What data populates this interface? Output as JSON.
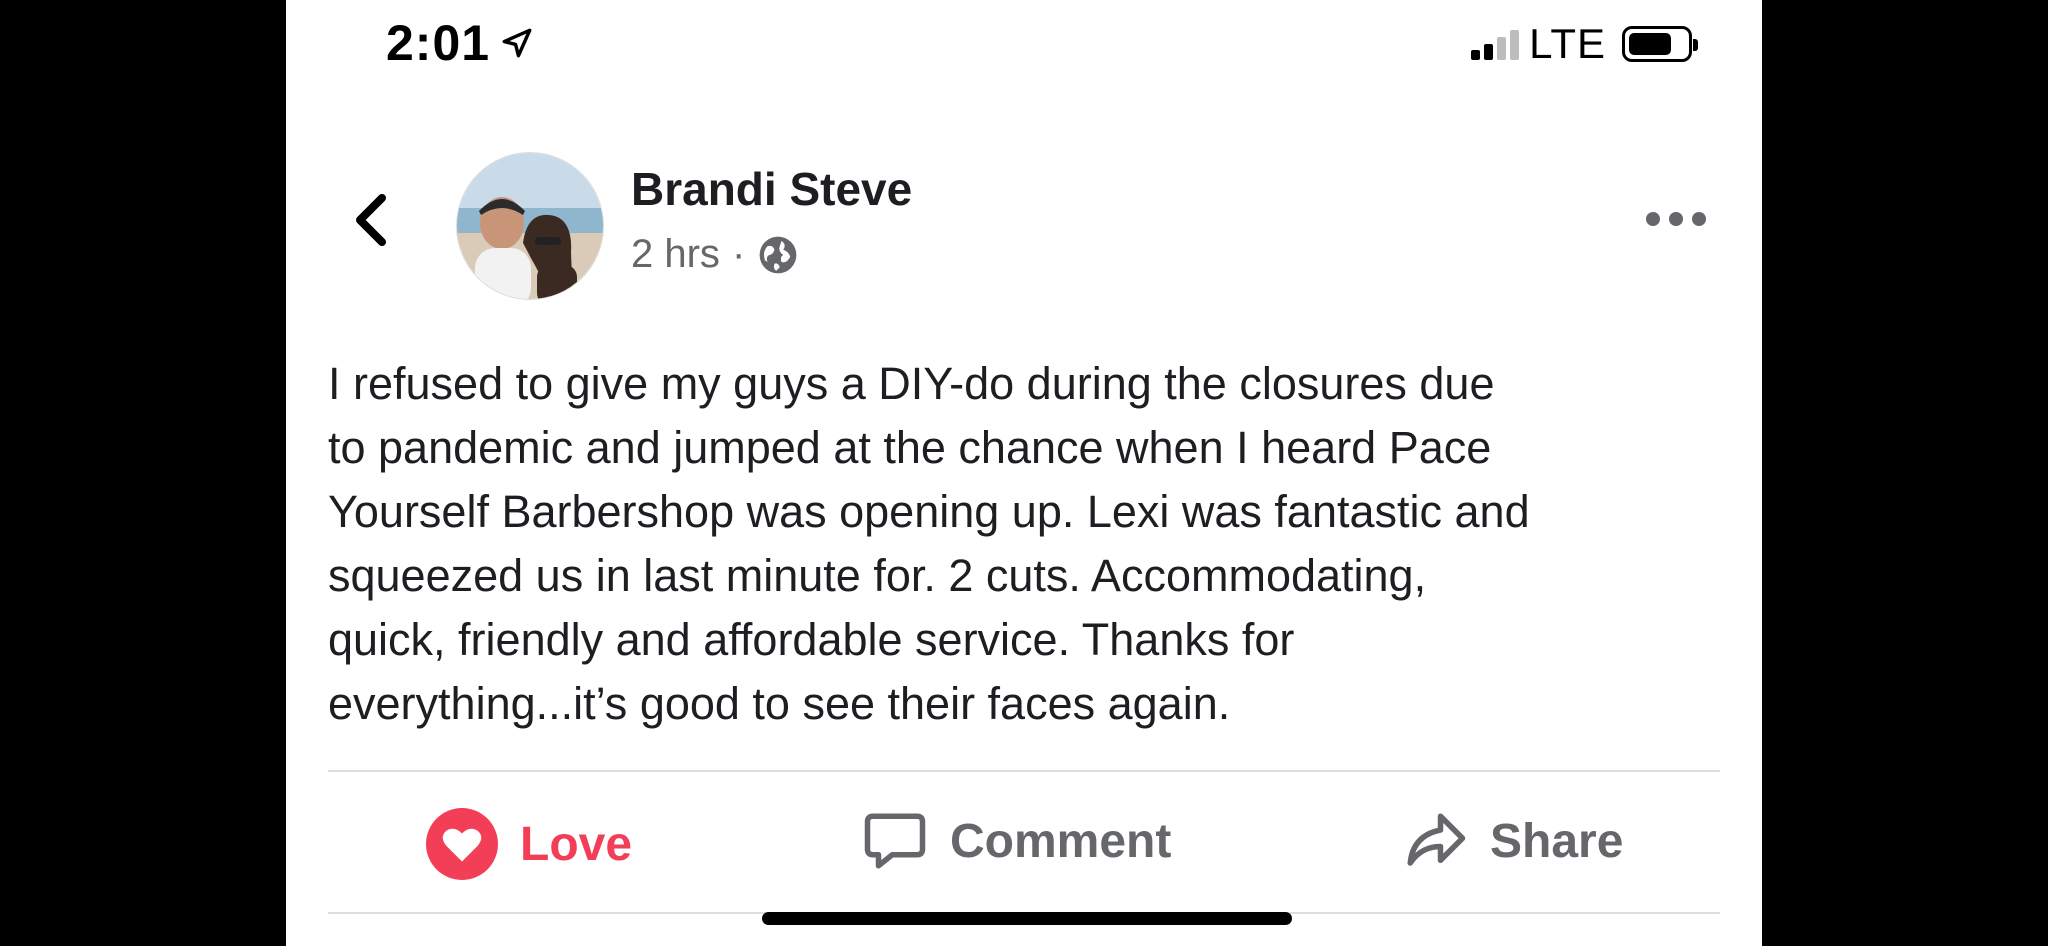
{
  "status_bar": {
    "time": "2:01",
    "network": "LTE",
    "icons": [
      "location-arrow-icon",
      "signal-icon",
      "battery-icon"
    ]
  },
  "post": {
    "author": "Brandi Steve",
    "time_ago": "2 hrs",
    "separator": "·",
    "privacy_icon": "globe-icon",
    "text": "I refused to give my guys a DIY-do during the closures due\nto pandemic and jumped at the chance when I heard Pace\nYourself Barbershop was opening up. Lexi was fantastic and\nsqueezed us in last minute for. 2 cuts. Accommodating,\nquick, friendly and affordable service. Thanks for\neverything...it’s good to see their faces again."
  },
  "actions": {
    "love_label": "Love",
    "comment_label": "Comment",
    "share_label": "Share"
  },
  "colors": {
    "love_accent": "#f33e58",
    "secondary_text": "#65676b",
    "primary_text": "#1c1e21"
  }
}
